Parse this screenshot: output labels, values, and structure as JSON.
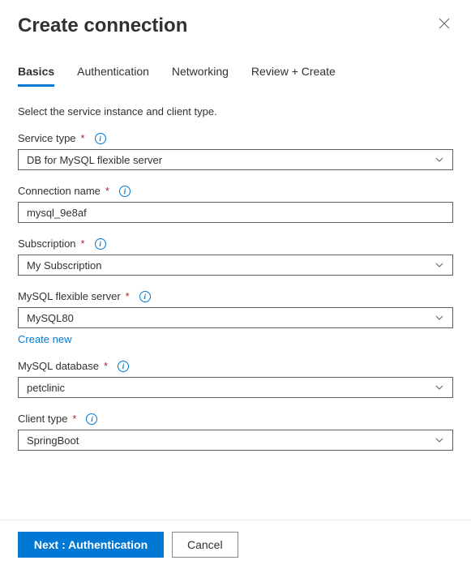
{
  "header": {
    "title": "Create connection"
  },
  "tabs": {
    "items": [
      {
        "label": "Basics",
        "active": true
      },
      {
        "label": "Authentication",
        "active": false
      },
      {
        "label": "Networking",
        "active": false
      },
      {
        "label": "Review + Create",
        "active": false
      }
    ]
  },
  "instruction": "Select the service instance and client type.",
  "fields": {
    "service_type": {
      "label": "Service type",
      "value": "DB for MySQL flexible server"
    },
    "connection_name": {
      "label": "Connection name",
      "value": "mysql_9e8af"
    },
    "subscription": {
      "label": "Subscription",
      "value": "My Subscription"
    },
    "mysql_server": {
      "label": "MySQL flexible server",
      "value": "MySQL80",
      "create_new": "Create new"
    },
    "mysql_database": {
      "label": "MySQL database",
      "value": "petclinic"
    },
    "client_type": {
      "label": "Client type",
      "value": "SpringBoot"
    }
  },
  "footer": {
    "next": "Next : Authentication",
    "cancel": "Cancel"
  }
}
